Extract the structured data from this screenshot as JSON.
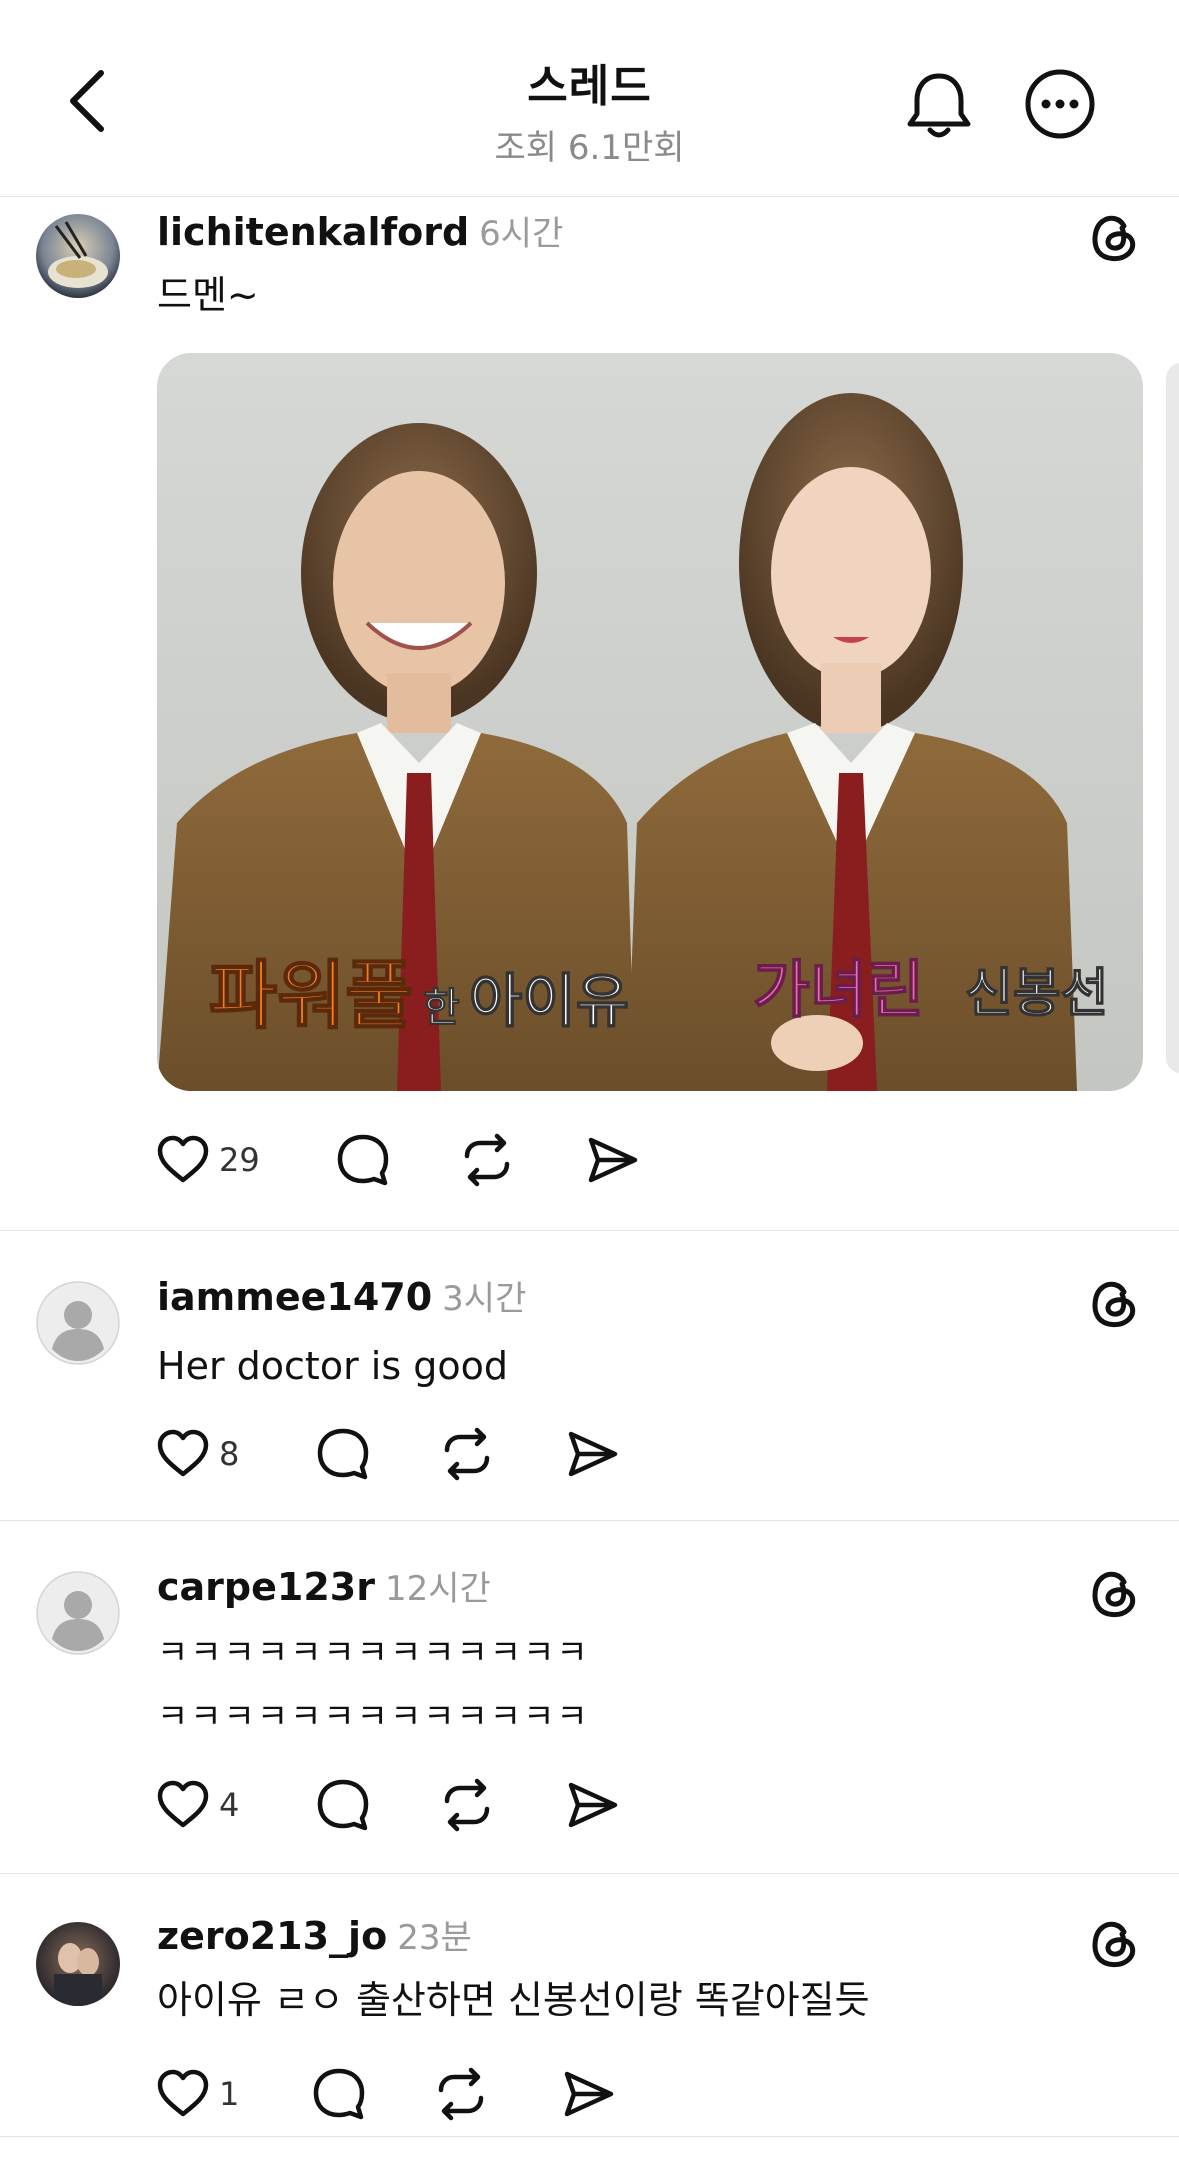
{
  "header": {
    "title": "스레드",
    "subtitle": "조회 6.1만회"
  },
  "posts": [
    {
      "username": "lichitenkalford",
      "time": "6시간",
      "text_lines": [
        "드멘~"
      ],
      "likes": "29",
      "image": {
        "caption_left_accent": "파워풀",
        "caption_left_small": "한",
        "caption_left_name": "아이유",
        "caption_right_accent": "가녀린",
        "caption_right_name": "신봉선"
      }
    },
    {
      "username": "iammee1470",
      "time": "3시간",
      "text_lines": [
        "Her doctor is good"
      ],
      "likes": "8"
    },
    {
      "username": "carpe123r",
      "time": "12시간",
      "text_lines": [
        "ㅋㅋㅋㅋㅋㅋㅋㅋㅋㅋㅋㅋㅋ",
        "ㅋㅋㅋㅋㅋㅋㅋㅋㅋㅋㅋㅋㅋ"
      ],
      "likes": "4"
    },
    {
      "username": "zero213_jo",
      "time": "23분",
      "text_lines": [
        "아이유 ㄹㅇ 출산하면 신봉선이랑 똑같아질듯"
      ],
      "likes": "1"
    }
  ],
  "colors": {
    "accent_orange": "#f47c1f",
    "accent_pink": "#f06ab8",
    "divider": "#e3e3e3",
    "muted_text": "#9a9a9a"
  },
  "icons": [
    "back-chevron-icon",
    "bell-icon",
    "more-icon",
    "threads-logo-icon",
    "heart-icon",
    "comment-icon",
    "repost-icon",
    "share-icon"
  ]
}
